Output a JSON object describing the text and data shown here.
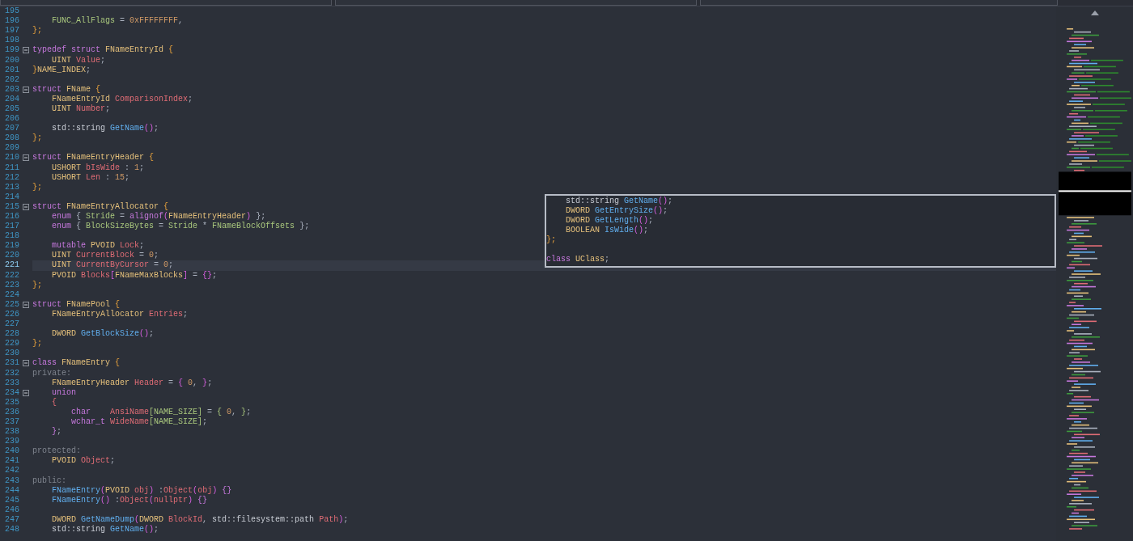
{
  "editor": {
    "lines": [
      {
        "n": "195",
        "fold": false,
        "current": false
      },
      {
        "n": "196",
        "fold": false,
        "current": false,
        "tokens": [
          {
            "kind": "en",
            "t": "    FUNC_AllFlags"
          },
          {
            "kind": "p",
            "t": " = "
          },
          {
            "kind": "num",
            "t": "0xFFFFFFFF"
          },
          {
            "kind": "p",
            "t": ","
          }
        ]
      },
      {
        "n": "197",
        "fold": false,
        "current": false,
        "tokens": [
          {
            "kind": "br",
            "t": "};"
          }
        ]
      },
      {
        "n": "198",
        "fold": false,
        "current": false
      },
      {
        "n": "199",
        "fold": true,
        "current": false,
        "tokens": [
          {
            "kind": "kw",
            "t": "typedef "
          },
          {
            "kind": "kw",
            "t": "struct"
          },
          {
            "kind": "ty",
            "t": " FNameEntryId "
          },
          {
            "kind": "br",
            "t": "{"
          }
        ]
      },
      {
        "n": "200",
        "fold": false,
        "current": false,
        "tokens": [
          {
            "kind": "ty",
            "t": "    UINT "
          },
          {
            "kind": "mem",
            "t": "Value"
          },
          {
            "kind": "p",
            "t": ";"
          }
        ]
      },
      {
        "n": "201",
        "fold": false,
        "current": false,
        "tokens": [
          {
            "kind": "br",
            "t": "}"
          },
          {
            "kind": "ty",
            "t": "NAME_INDEX"
          },
          {
            "kind": "p",
            "t": ";"
          }
        ]
      },
      {
        "n": "202",
        "fold": false,
        "current": false
      },
      {
        "n": "203",
        "fold": true,
        "current": false,
        "tokens": [
          {
            "kind": "kw",
            "t": "struct"
          },
          {
            "kind": "ty",
            "t": " FName "
          },
          {
            "kind": "br",
            "t": "{"
          }
        ]
      },
      {
        "n": "204",
        "fold": false,
        "current": false,
        "tokens": [
          {
            "kind": "ty",
            "t": "    FNameEntryId "
          },
          {
            "kind": "mem",
            "t": "ComparisonIndex"
          },
          {
            "kind": "p",
            "t": ";"
          }
        ]
      },
      {
        "n": "205",
        "fold": false,
        "current": false,
        "tokens": [
          {
            "kind": "ty",
            "t": "    UINT "
          },
          {
            "kind": "mem",
            "t": "Number"
          },
          {
            "kind": "p",
            "t": ";"
          }
        ]
      },
      {
        "n": "206",
        "fold": false,
        "current": false
      },
      {
        "n": "207",
        "fold": false,
        "current": false,
        "tokens": [
          {
            "kind": "id",
            "t": "    std::string "
          },
          {
            "kind": "fn",
            "t": "GetName"
          },
          {
            "kind": "par",
            "t": "()"
          },
          {
            "kind": "p",
            "t": ";"
          }
        ]
      },
      {
        "n": "208",
        "fold": false,
        "current": false,
        "tokens": [
          {
            "kind": "br",
            "t": "};"
          }
        ]
      },
      {
        "n": "209",
        "fold": false,
        "current": false
      },
      {
        "n": "210",
        "fold": true,
        "current": false,
        "tokens": [
          {
            "kind": "kw",
            "t": "struct"
          },
          {
            "kind": "ty",
            "t": " FNameEntryHeader "
          },
          {
            "kind": "br",
            "t": "{"
          }
        ]
      },
      {
        "n": "211",
        "fold": false,
        "current": false,
        "tokens": [
          {
            "kind": "ty",
            "t": "    USHORT "
          },
          {
            "kind": "mem",
            "t": "bIsWide"
          },
          {
            "kind": "p",
            "t": " : "
          },
          {
            "kind": "num",
            "t": "1"
          },
          {
            "kind": "p",
            "t": ";"
          }
        ]
      },
      {
        "n": "212",
        "fold": false,
        "current": false,
        "tokens": [
          {
            "kind": "ty",
            "t": "    USHORT "
          },
          {
            "kind": "mem",
            "t": "Len"
          },
          {
            "kind": "p",
            "t": " : "
          },
          {
            "kind": "num",
            "t": "15"
          },
          {
            "kind": "p",
            "t": ";"
          }
        ]
      },
      {
        "n": "213",
        "fold": false,
        "current": false,
        "tokens": [
          {
            "kind": "br",
            "t": "};"
          }
        ]
      },
      {
        "n": "214",
        "fold": false,
        "current": false
      },
      {
        "n": "215",
        "fold": true,
        "current": false,
        "tokens": [
          {
            "kind": "kw",
            "t": "struct"
          },
          {
            "kind": "ty",
            "t": " FNameEntryAllocator "
          },
          {
            "kind": "br",
            "t": "{"
          }
        ]
      },
      {
        "n": "216",
        "fold": false,
        "current": false,
        "tokens": [
          {
            "kind": "kw",
            "t": "    enum"
          },
          {
            "kind": "p",
            "t": " { "
          },
          {
            "kind": "en",
            "t": "Stride"
          },
          {
            "kind": "p",
            "t": " = "
          },
          {
            "kind": "kw",
            "t": "alignof"
          },
          {
            "kind": "par",
            "t": "("
          },
          {
            "kind": "ty",
            "t": "FNameEntryHeader"
          },
          {
            "kind": "par",
            "t": ")"
          },
          {
            "kind": "p",
            "t": " };"
          }
        ]
      },
      {
        "n": "217",
        "fold": false,
        "current": false,
        "tokens": [
          {
            "kind": "kw",
            "t": "    enum"
          },
          {
            "kind": "p",
            "t": " { "
          },
          {
            "kind": "en",
            "t": "BlockSizeBytes"
          },
          {
            "kind": "p",
            "t": " = "
          },
          {
            "kind": "en",
            "t": "Stride"
          },
          {
            "kind": "p",
            "t": " * "
          },
          {
            "kind": "en",
            "t": "FNameBlockOffsets"
          },
          {
            "kind": "p",
            "t": " };"
          }
        ]
      },
      {
        "n": "218",
        "fold": false,
        "current": false
      },
      {
        "n": "219",
        "fold": false,
        "current": false,
        "tokens": [
          {
            "kind": "kw",
            "t": "    mutable"
          },
          {
            "kind": "ty",
            "t": " PVOID "
          },
          {
            "kind": "mem",
            "t": "Lock"
          },
          {
            "kind": "p",
            "t": ";"
          }
        ]
      },
      {
        "n": "220",
        "fold": false,
        "current": false,
        "tokens": [
          {
            "kind": "ty",
            "t": "    UINT "
          },
          {
            "kind": "mem",
            "t": "CurrentBlock"
          },
          {
            "kind": "p",
            "t": " = "
          },
          {
            "kind": "num",
            "t": "0"
          },
          {
            "kind": "p",
            "t": ";"
          }
        ]
      },
      {
        "n": "221",
        "fold": false,
        "current": true,
        "tokens": [
          {
            "kind": "ty",
            "t": "    UINT "
          },
          {
            "kind": "mem",
            "t": "CurrentByCursor"
          },
          {
            "kind": "p",
            "t": " = "
          },
          {
            "kind": "num",
            "t": "0"
          },
          {
            "kind": "p",
            "t": ";"
          }
        ]
      },
      {
        "n": "222",
        "fold": false,
        "current": false,
        "tokens": [
          {
            "kind": "ty",
            "t": "    PVOID "
          },
          {
            "kind": "mem",
            "t": "Blocks"
          },
          {
            "kind": "par",
            "t": "["
          },
          {
            "kind": "ty",
            "t": "FNameMaxBlocks"
          },
          {
            "kind": "par",
            "t": "]"
          },
          {
            "kind": "p",
            "t": " = "
          },
          {
            "kind": "par",
            "t": "{}"
          },
          {
            "kind": "p",
            "t": ";"
          }
        ]
      },
      {
        "n": "223",
        "fold": false,
        "current": false,
        "tokens": [
          {
            "kind": "br",
            "t": "};"
          }
        ]
      },
      {
        "n": "224",
        "fold": false,
        "current": false
      },
      {
        "n": "225",
        "fold": true,
        "current": false,
        "tokens": [
          {
            "kind": "kw",
            "t": "struct"
          },
          {
            "kind": "ty",
            "t": " FNamePool "
          },
          {
            "kind": "br",
            "t": "{"
          }
        ]
      },
      {
        "n": "226",
        "fold": false,
        "current": false,
        "tokens": [
          {
            "kind": "ty",
            "t": "    FNameEntryAllocator "
          },
          {
            "kind": "mem",
            "t": "Entries"
          },
          {
            "kind": "p",
            "t": ";"
          }
        ]
      },
      {
        "n": "227",
        "fold": false,
        "current": false
      },
      {
        "n": "228",
        "fold": false,
        "current": false,
        "tokens": [
          {
            "kind": "ty",
            "t": "    DWORD "
          },
          {
            "kind": "fn",
            "t": "GetBlockSize"
          },
          {
            "kind": "par",
            "t": "()"
          },
          {
            "kind": "p",
            "t": ";"
          }
        ]
      },
      {
        "n": "229",
        "fold": false,
        "current": false,
        "tokens": [
          {
            "kind": "br",
            "t": "};"
          }
        ]
      },
      {
        "n": "230",
        "fold": false,
        "current": false
      },
      {
        "n": "231",
        "fold": true,
        "current": false,
        "tokens": [
          {
            "kind": "kw",
            "t": "class"
          },
          {
            "kind": "ty",
            "t": " FNameEntry "
          },
          {
            "kind": "br",
            "t": "{"
          }
        ]
      },
      {
        "n": "232",
        "fold": false,
        "current": false,
        "tokens": [
          {
            "kind": "lab",
            "t": "private:"
          }
        ]
      },
      {
        "n": "233",
        "fold": false,
        "current": false,
        "tokens": [
          {
            "kind": "ty",
            "t": "    FNameEntryHeader "
          },
          {
            "kind": "mem",
            "t": "Header"
          },
          {
            "kind": "p",
            "t": " = "
          },
          {
            "kind": "par",
            "t": "{ "
          },
          {
            "kind": "num",
            "t": "0"
          },
          {
            "kind": "p",
            "t": ", "
          },
          {
            "kind": "par",
            "t": "}"
          },
          {
            "kind": "p",
            "t": ";"
          }
        ]
      },
      {
        "n": "234",
        "fold": true,
        "current": false,
        "tokens": [
          {
            "kind": "kw",
            "t": "    union"
          }
        ]
      },
      {
        "n": "235",
        "fold": false,
        "current": false,
        "tokens": [
          {
            "kind": "mem",
            "t": "    {"
          }
        ]
      },
      {
        "n": "236",
        "fold": false,
        "current": false,
        "tokens": [
          {
            "kind": "kw",
            "t": "        char    "
          },
          {
            "kind": "mem",
            "t": "AnsiName"
          },
          {
            "kind": "en",
            "t": "[NAME_SIZE]"
          },
          {
            "kind": "p",
            "t": " = "
          },
          {
            "kind": "en",
            "t": "{ "
          },
          {
            "kind": "num",
            "t": "0"
          },
          {
            "kind": "p",
            "t": ", "
          },
          {
            "kind": "en",
            "t": "}"
          },
          {
            "kind": "p",
            "t": ";"
          }
        ]
      },
      {
        "n": "237",
        "fold": false,
        "current": false,
        "tokens": [
          {
            "kind": "kw",
            "t": "        wchar_t "
          },
          {
            "kind": "mem",
            "t": "WideName"
          },
          {
            "kind": "en",
            "t": "[NAME_SIZE]"
          },
          {
            "kind": "p",
            "t": ";"
          }
        ]
      },
      {
        "n": "238",
        "fold": false,
        "current": false,
        "tokens": [
          {
            "kind": "kw",
            "t": "    }"
          },
          {
            "kind": "p",
            "t": ";"
          }
        ]
      },
      {
        "n": "239",
        "fold": false,
        "current": false
      },
      {
        "n": "240",
        "fold": false,
        "current": false,
        "tokens": [
          {
            "kind": "lab",
            "t": "protected:"
          }
        ]
      },
      {
        "n": "241",
        "fold": false,
        "current": false,
        "tokens": [
          {
            "kind": "ty",
            "t": "    PVOID "
          },
          {
            "kind": "mem",
            "t": "Object"
          },
          {
            "kind": "p",
            "t": ";"
          }
        ]
      },
      {
        "n": "242",
        "fold": false,
        "current": false
      },
      {
        "n": "243",
        "fold": false,
        "current": false,
        "tokens": [
          {
            "kind": "lab",
            "t": "public:"
          }
        ]
      },
      {
        "n": "244",
        "fold": false,
        "current": false,
        "tokens": [
          {
            "kind": "fn",
            "t": "    FNameEntry"
          },
          {
            "kind": "par",
            "t": "("
          },
          {
            "kind": "ty",
            "t": "PVOID "
          },
          {
            "kind": "mem",
            "t": "obj"
          },
          {
            "kind": "par",
            "t": ")"
          },
          {
            "kind": "p",
            "t": " :"
          },
          {
            "kind": "mem",
            "t": "Object"
          },
          {
            "kind": "par",
            "t": "("
          },
          {
            "kind": "mem",
            "t": "obj"
          },
          {
            "kind": "par",
            "t": ")"
          },
          {
            "kind": "kw",
            "t": " {}"
          }
        ]
      },
      {
        "n": "245",
        "fold": false,
        "current": false,
        "tokens": [
          {
            "kind": "fn",
            "t": "    FNameEntry"
          },
          {
            "kind": "par",
            "t": "()"
          },
          {
            "kind": "p",
            "t": " :"
          },
          {
            "kind": "mem",
            "t": "Object"
          },
          {
            "kind": "par",
            "t": "("
          },
          {
            "kind": "mem",
            "t": "nullptr"
          },
          {
            "kind": "par",
            "t": ")"
          },
          {
            "kind": "kw",
            "t": " {}"
          }
        ]
      },
      {
        "n": "246",
        "fold": false,
        "current": false
      },
      {
        "n": "247",
        "fold": false,
        "current": false,
        "tokens": [
          {
            "kind": "ty",
            "t": "    DWORD "
          },
          {
            "kind": "fn",
            "t": "GetNameDump"
          },
          {
            "kind": "par",
            "t": "("
          },
          {
            "kind": "ty",
            "t": "DWORD "
          },
          {
            "kind": "mem",
            "t": "BlockId"
          },
          {
            "kind": "p",
            "t": ", "
          },
          {
            "kind": "id",
            "t": "std::filesystem::path "
          },
          {
            "kind": "mem",
            "t": "Path"
          },
          {
            "kind": "par",
            "t": ")"
          },
          {
            "kind": "p",
            "t": ";"
          }
        ]
      },
      {
        "n": "248",
        "fold": false,
        "current": false,
        "tokens": [
          {
            "kind": "id",
            "t": "    std::string "
          },
          {
            "kind": "fn",
            "t": "GetName"
          },
          {
            "kind": "par",
            "t": "()"
          },
          {
            "kind": "p",
            "t": ";"
          }
        ]
      }
    ]
  },
  "peek": {
    "lines": [
      {
        "tokens": [
          {
            "kind": "id",
            "t": "    std::string "
          },
          {
            "kind": "fn",
            "t": "GetName"
          },
          {
            "kind": "par",
            "t": "()"
          },
          {
            "kind": "p",
            "t": ";"
          }
        ]
      },
      {
        "tokens": [
          {
            "kind": "ty",
            "t": "    DWORD "
          },
          {
            "kind": "fn",
            "t": "GetEntrySize"
          },
          {
            "kind": "par",
            "t": "()"
          },
          {
            "kind": "p",
            "t": ";"
          }
        ]
      },
      {
        "tokens": [
          {
            "kind": "ty",
            "t": "    DWORD "
          },
          {
            "kind": "fn",
            "t": "GetLength"
          },
          {
            "kind": "par",
            "t": "()"
          },
          {
            "kind": "p",
            "t": ";"
          }
        ]
      },
      {
        "tokens": [
          {
            "kind": "ty",
            "t": "    BOOLEAN "
          },
          {
            "kind": "fn",
            "t": "IsWide"
          },
          {
            "kind": "par",
            "t": "()"
          },
          {
            "kind": "p",
            "t": ";"
          }
        ]
      },
      {
        "tokens": [
          {
            "kind": "br",
            "t": "};"
          }
        ]
      }
    ],
    "trailing_line": {
      "tokens": [
        {
          "kind": "kw",
          "t": "class"
        },
        {
          "kind": "ty",
          "t": " UClass"
        },
        {
          "kind": "p",
          "t": ";"
        }
      ]
    }
  }
}
